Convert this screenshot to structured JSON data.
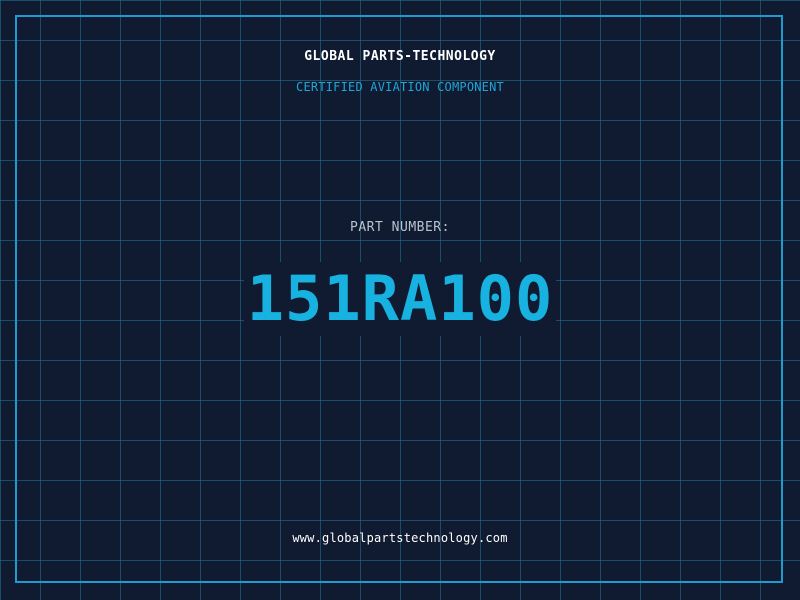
{
  "header": {
    "company": "GLOBAL PARTS-TECHNOLOGY",
    "tagline": "CERTIFIED AVIATION COMPONENT"
  },
  "part": {
    "label": "PART NUMBER:",
    "number": "151RA100"
  },
  "footer": {
    "website": "www.globalpartstechnology.com"
  },
  "colors": {
    "background": "#101a30",
    "grid": "#1f7896",
    "accent": "#17b2e0",
    "frame": "#1e9ccf",
    "text_primary": "#ffffff",
    "text_muted": "#b8c4d0"
  }
}
